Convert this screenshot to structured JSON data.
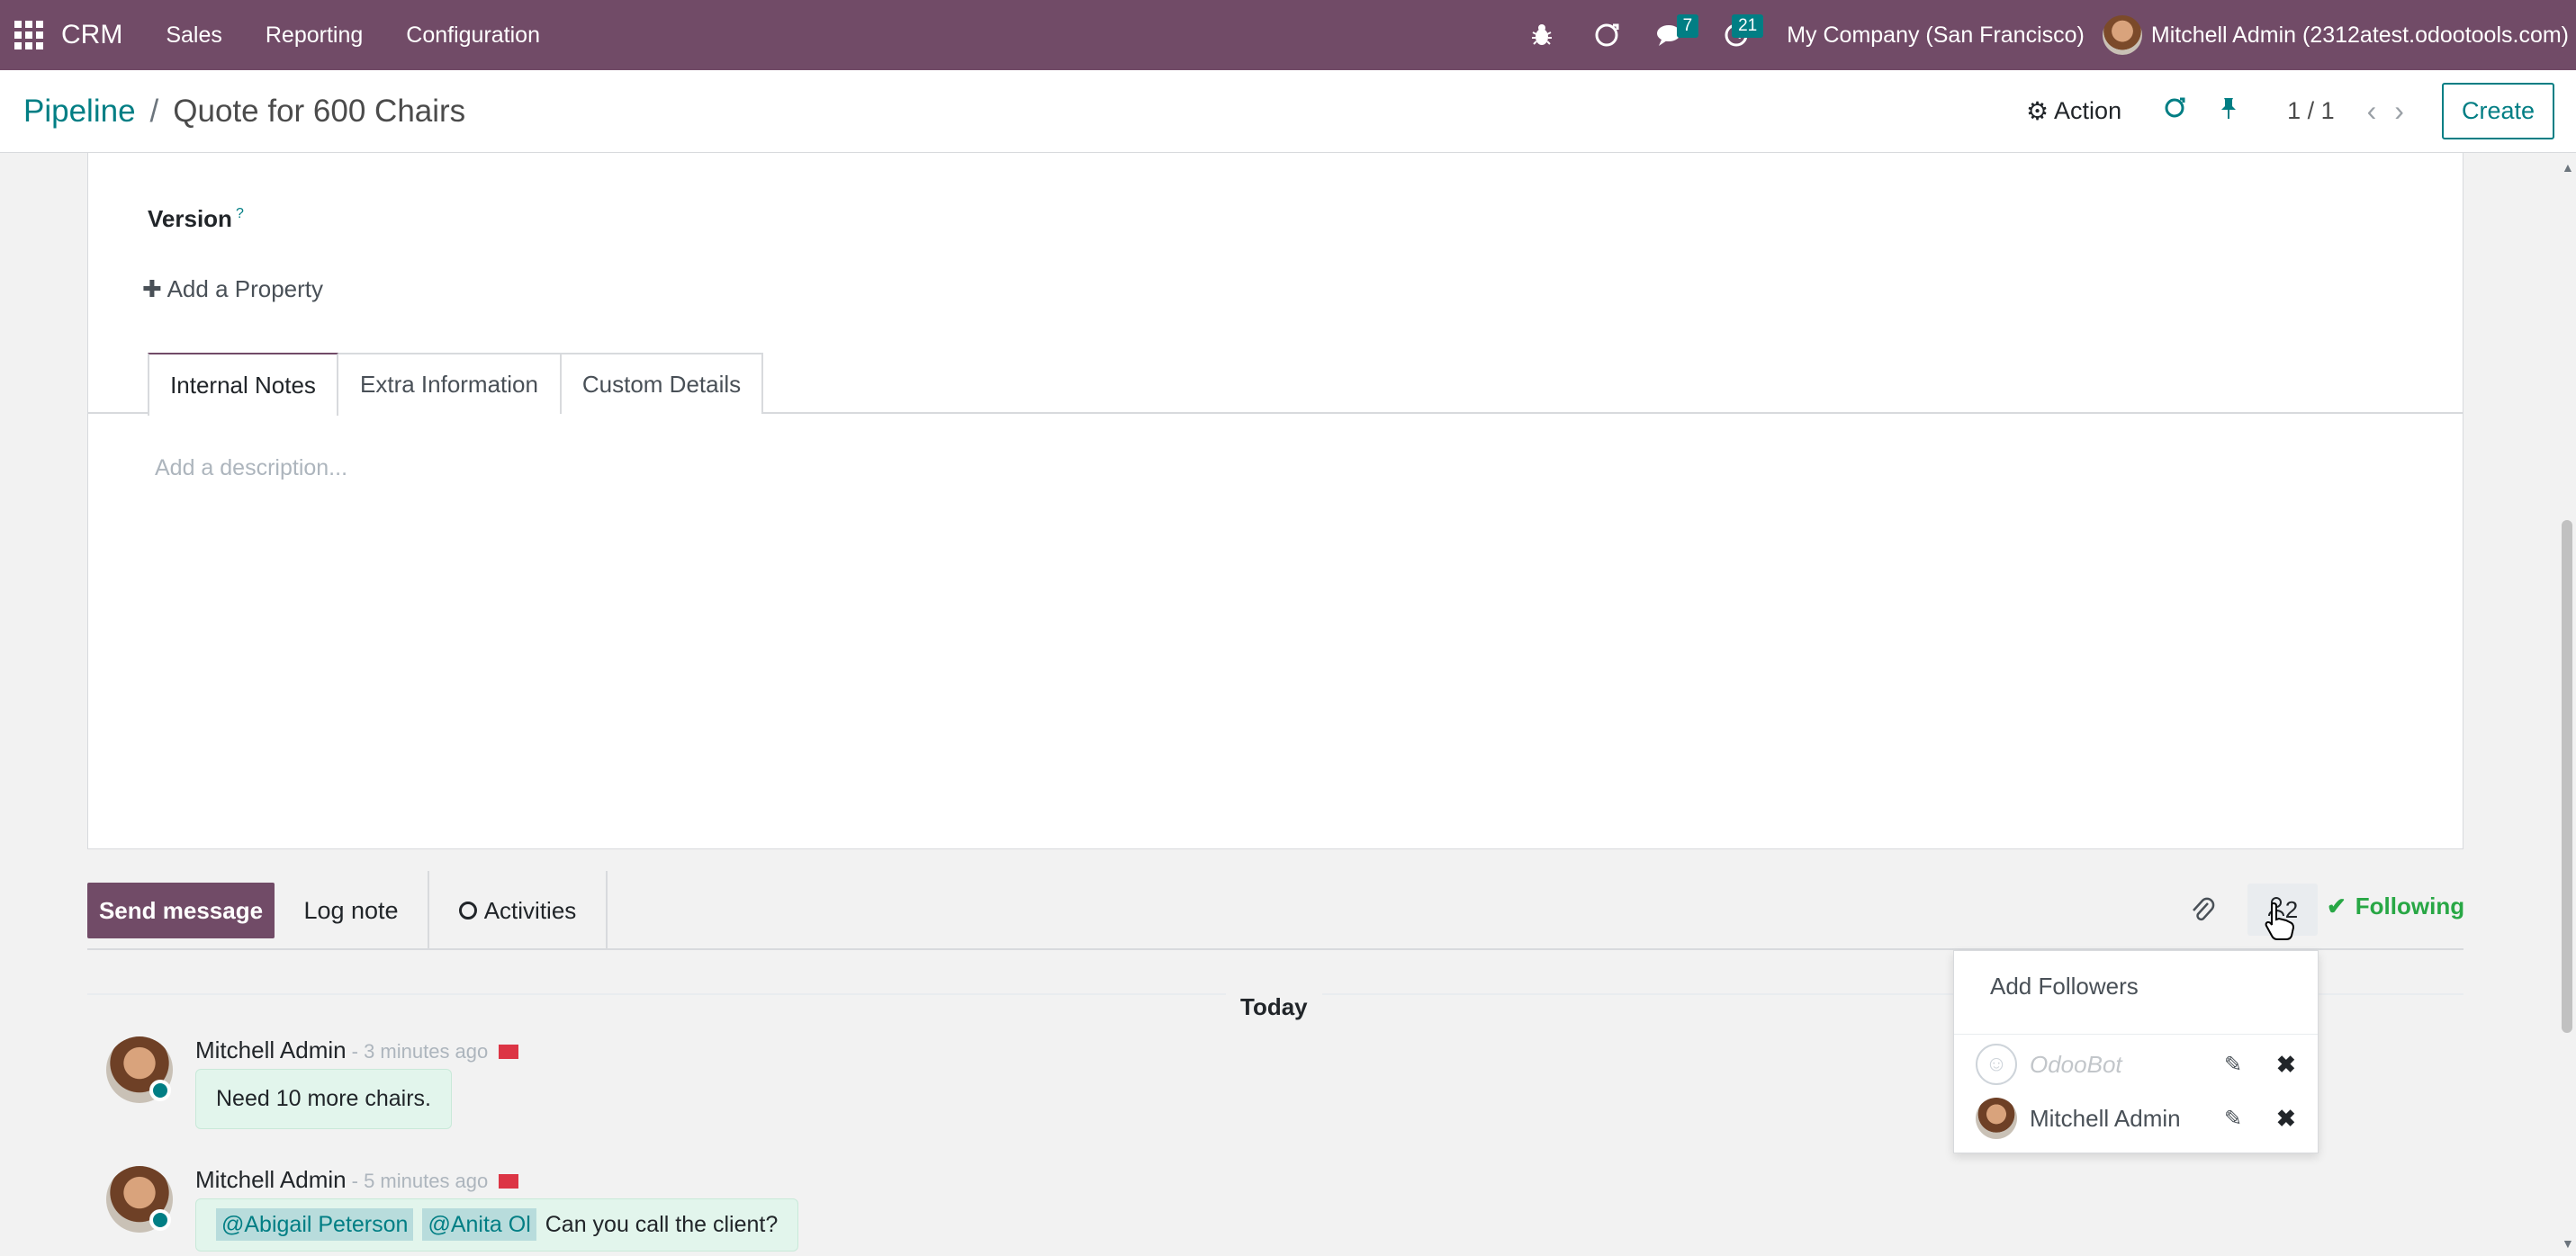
{
  "navbar": {
    "brand": "CRM",
    "menu": [
      "Sales",
      "Reporting",
      "Configuration"
    ],
    "messages_badge": "7",
    "activities_badge": "21",
    "company": "My Company (San Francisco)",
    "user": "Mitchell Admin (2312atest.odootools.com)"
  },
  "control": {
    "breadcrumb_parent": "Pipeline",
    "breadcrumb_current": "Quote for 600 Chairs",
    "action_label": "Action",
    "pager": "1 / 1",
    "create_label": "Create"
  },
  "form": {
    "version_label": "Version",
    "version_help": "?",
    "add_property": "Add a Property",
    "tabs": [
      "Internal Notes",
      "Extra Information",
      "Custom Details"
    ],
    "description_placeholder": "Add a description..."
  },
  "chatter": {
    "send_message": "Send message",
    "log_note": "Log note",
    "activities": "Activities",
    "followers_count": "2",
    "following": "Following",
    "today": "Today",
    "messages": [
      {
        "author": "Mitchell Admin",
        "time": "- 3 minutes ago",
        "body": "Need 10 more chairs."
      },
      {
        "author": "Mitchell Admin",
        "time": "- 5 minutes ago",
        "mentions": [
          "@Abigail Peterson",
          "@Anita Ol"
        ],
        "body": "Can you call the client?"
      }
    ]
  },
  "followers_dropdown": {
    "add_followers": "Add Followers",
    "followers": [
      "OdooBot",
      "Mitchell Admin"
    ]
  },
  "colors": {
    "brand": "#714b67",
    "accent": "#017e84",
    "success": "#28a745"
  }
}
